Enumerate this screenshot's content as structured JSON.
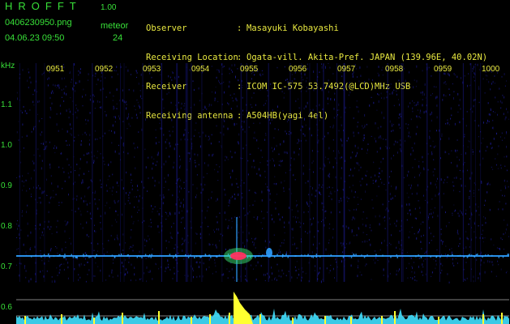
{
  "header": {
    "app_title": "HROFFT",
    "app_version": "1.00",
    "file_name": "0406230950.png",
    "timestamp": "04.06.23 09:50",
    "meteor_label": "meteor",
    "meteor_count": "24"
  },
  "metadata": [
    {
      "label": "Observer",
      "value": "Masayuki Kobayashi"
    },
    {
      "label": "Receiving Location",
      "value": "Ogata-vill. Akita-Pref. JAPAN (139.96E, 40.02N)"
    },
    {
      "label": "Receiver",
      "value": "ICOM IC-575 53.7492(@LCD)MHz USB"
    },
    {
      "label": "Receiving antenna",
      "value": "A504HB(yagi 4el)"
    }
  ],
  "spectrogram": {
    "unit_label": "kHz",
    "y_ticks": [
      "1.1",
      "1.0",
      "0.9",
      "0.8",
      "0.7",
      "0.6"
    ],
    "x_ticks": [
      "0951",
      "0952",
      "0953",
      "0954",
      "0955",
      "0956",
      "0957",
      "0958",
      "0959",
      "1000"
    ],
    "colors": {
      "background": "#000000",
      "noise": "#1a1a8a",
      "carrier": "#2fa0ff",
      "echo_core": "#ff3060",
      "echo_halo": "#40ff80",
      "bottom_spectrum": "#40e0ff",
      "meteor_peak": "#ffff30",
      "guide_line": "#a0a0a0"
    }
  }
}
